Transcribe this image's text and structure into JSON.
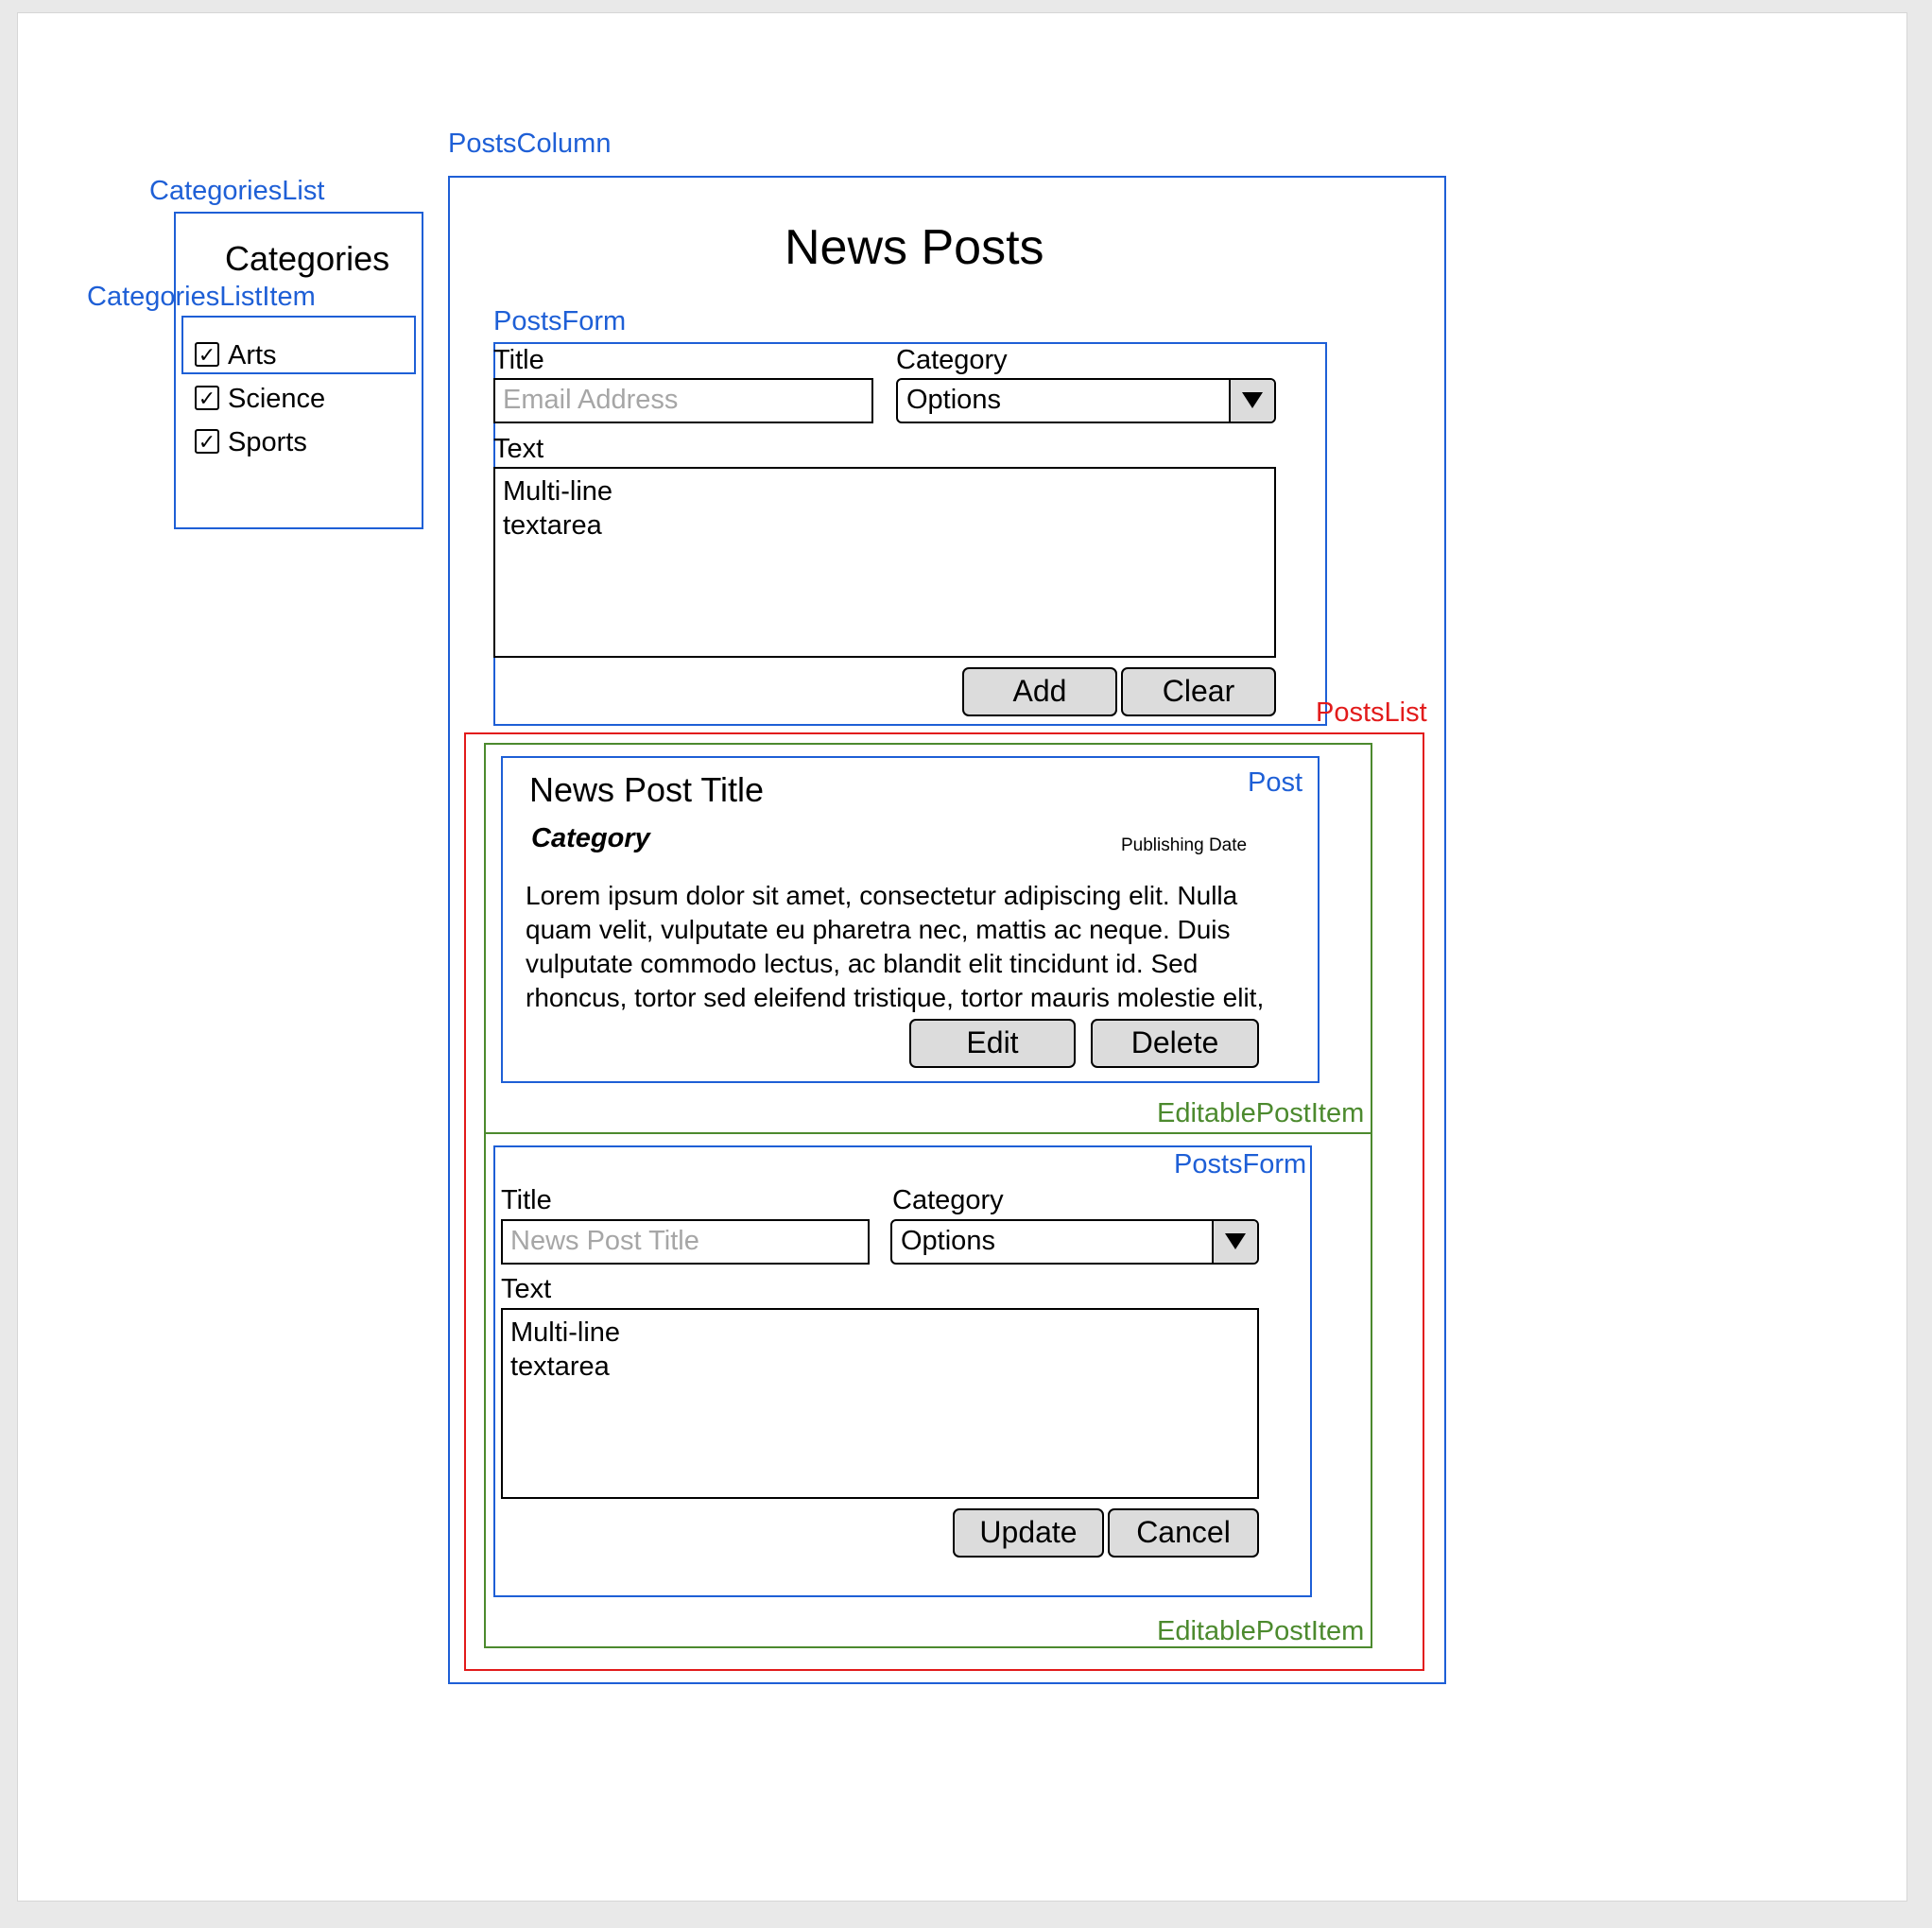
{
  "component_labels": {
    "posts_column": "PostsColumn",
    "categories_list": "CategoriesList",
    "categories_list_item": "CategoriesListItem",
    "posts_form": "PostsForm",
    "posts_list": "PostsList",
    "post": "Post",
    "editable_post_item": "EditablePostItem",
    "editable_post_item_2": "EditablePostItem",
    "posts_form_2": "PostsForm"
  },
  "categories": {
    "heading": "Categories",
    "items": [
      {
        "label": "Arts",
        "checked": true
      },
      {
        "label": "Science",
        "checked": true
      },
      {
        "label": "Sports",
        "checked": true
      }
    ],
    "check_glyph": "✓"
  },
  "posts_column": {
    "title": "News Posts"
  },
  "posts_form": {
    "title_label": "Title",
    "title_placeholder": "Email Address",
    "category_label": "Category",
    "category_value": "Options",
    "text_label": "Text",
    "text_value": "Multi-line\ntextarea",
    "add_button": "Add",
    "clear_button": "Clear"
  },
  "post": {
    "title": "News Post Title",
    "category": "Category",
    "publishing_date": "Publishing Date",
    "body": "Lorem ipsum dolor sit amet, consectetur adipiscing elit. Nulla quam velit, vulputate eu pharetra nec, mattis ac neque. Duis vulputate commodo lectus, ac blandit elit tincidunt id. Sed rhoncus, tortor sed eleifend tristique, tortor mauris molestie elit,",
    "edit_button": "Edit",
    "delete_button": "Delete"
  },
  "edit_form": {
    "title_label": "Title",
    "title_placeholder": "News Post Title",
    "category_label": "Category",
    "category_value": "Options",
    "text_label": "Text",
    "text_value": "Multi-line\ntextarea",
    "update_button": "Update",
    "cancel_button": "Cancel"
  },
  "colors": {
    "blue_annotation": "#1e5fd6",
    "red_annotation": "#e21b1b",
    "green_annotation": "#4c8a2e",
    "button_fill": "#dcdcdc"
  },
  "icons": {
    "checkbox": "check-icon",
    "dropdown": "triangle-down-icon"
  }
}
